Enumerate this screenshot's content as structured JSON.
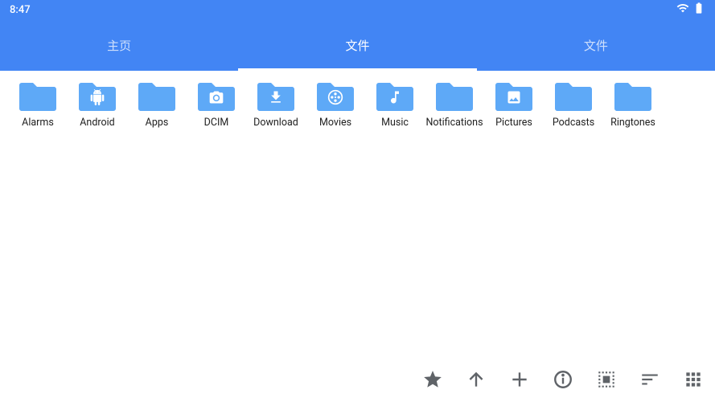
{
  "status": {
    "time": "8:47"
  },
  "tabs": [
    {
      "label": "主页",
      "active": false
    },
    {
      "label": "文件",
      "active": true
    },
    {
      "label": "文件",
      "active": false
    }
  ],
  "folders": [
    {
      "name": "Alarms",
      "icon": "none"
    },
    {
      "name": "Android",
      "icon": "android"
    },
    {
      "name": "Apps",
      "icon": "none"
    },
    {
      "name": "DCIM",
      "icon": "camera"
    },
    {
      "name": "Download",
      "icon": "download"
    },
    {
      "name": "Movies",
      "icon": "movie"
    },
    {
      "name": "Music",
      "icon": "music"
    },
    {
      "name": "Notifications",
      "icon": "none"
    },
    {
      "name": "Pictures",
      "icon": "picture"
    },
    {
      "name": "Podcasts",
      "icon": "none"
    },
    {
      "name": "Ringtones",
      "icon": "none"
    }
  ],
  "colors": {
    "primary": "#4285f4",
    "folder": "#5ea9f7"
  }
}
